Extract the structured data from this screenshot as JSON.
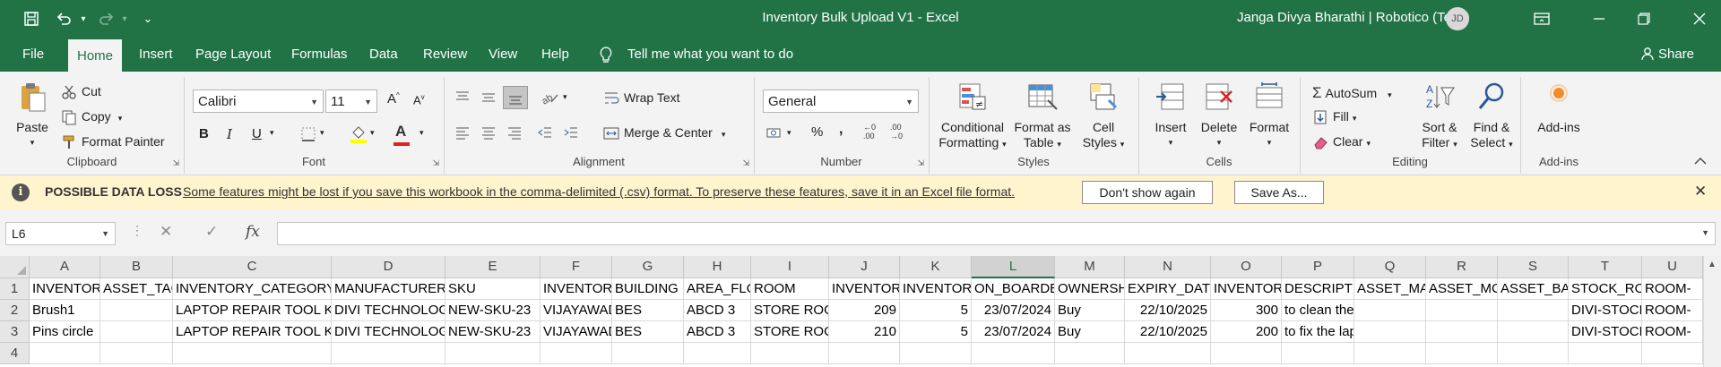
{
  "titlebar": {
    "title": "Inventory Bulk Upload V1  -  Excel",
    "user": "Janga Divya Bharathi | Robotico (Tech)",
    "initials": "JD",
    "qa_more": "⌄"
  },
  "tabs": [
    "File",
    "Home",
    "Insert",
    "Page Layout",
    "Formulas",
    "Data",
    "Review",
    "View",
    "Help"
  ],
  "tell_me": "Tell me what you want to do",
  "share": "Share",
  "ribbon": {
    "clipboard": {
      "paste": "Paste",
      "cut": "Cut",
      "copy": "Copy",
      "format_painter": "Format Painter",
      "label": "Clipboard"
    },
    "font": {
      "name": "Calibri",
      "size": "11",
      "label": "Font",
      "bold": "B",
      "italic": "I",
      "underline": "U"
    },
    "alignment": {
      "wrap": "Wrap Text",
      "merge": "Merge & Center",
      "label": "Alignment"
    },
    "number": {
      "format": "General",
      "percent": "%",
      "comma": ",",
      "label": "Number"
    },
    "styles": {
      "conditional": "Conditional",
      "conditional2": "Formatting",
      "format_table": "Format as",
      "format_table2": "Table",
      "cell_styles": "Cell",
      "cell_styles2": "Styles",
      "label": "Styles"
    },
    "cells": {
      "insert": "Insert",
      "delete": "Delete",
      "format": "Format",
      "label": "Cells"
    },
    "editing": {
      "autosum": "AutoSum",
      "fill": "Fill",
      "clear": "Clear",
      "sort": "Sort &",
      "sort2": "Filter",
      "find": "Find &",
      "find2": "Select",
      "label": "Editing"
    },
    "addins": {
      "addins": "Add-ins",
      "label": "Add-ins"
    }
  },
  "message": {
    "title": "POSSIBLE DATA LOSS",
    "text": "Some features might be lost if you save this workbook in the comma-delimited (.csv) format. To preserve these features, save it in an Excel file format.",
    "dont_show": "Don't show again",
    "save_as": "Save As..."
  },
  "formula_bar": {
    "name_box": "L6",
    "fx": "fx",
    "value": ""
  },
  "grid": {
    "columns": [
      "A",
      "B",
      "C",
      "D",
      "E",
      "F",
      "G",
      "H",
      "I",
      "J",
      "K",
      "L",
      "M",
      "N",
      "O",
      "P",
      "Q",
      "R",
      "S",
      "T",
      "U"
    ],
    "selected_column": "L",
    "rows": [
      "1",
      "2",
      "3",
      "4"
    ],
    "cells": [
      [
        "INVENTORY_NAME",
        "ASSET_TAG",
        "INVENTORY_CATEGORY",
        "MANUFACTURER",
        "SKU",
        "INVENTORY",
        "BUILDING",
        "AREA_FLOOR",
        "ROOM",
        "INVENTORY",
        "INVENTORY",
        "ON_BOARDED",
        "OWNERSHIP",
        "EXPIRY_DATE",
        "INVENTORY",
        "DESCRIPTION",
        "ASSET_MA",
        "ASSET_MC",
        "ASSET_BAI",
        "STOCK_ROOM",
        "ROOM-"
      ],
      [
        "Brush1",
        "",
        "LAPTOP REPAIR TOOL KIT",
        "DIVI TECHNOLOGIES",
        "NEW-SKU-23",
        "VIJAYAWADA",
        "BES",
        "ABCD 3",
        "STORE ROOM",
        "209",
        "5",
        "23/07/2024",
        "Buy",
        "22/10/2025",
        "300",
        "to clean the laptop",
        "",
        "",
        "",
        "DIVI-STOCK",
        "ROOM-"
      ],
      [
        "Pins circle",
        "",
        "LAPTOP REPAIR TOOL KIT",
        "DIVI TECHNOLOGIES",
        "NEW-SKU-23",
        "VIJAYAWADA",
        "BES",
        "ABCD 3",
        "STORE ROOM",
        "210",
        "5",
        "23/07/2024",
        "Buy",
        "22/10/2025",
        "200",
        "to fix the laptop",
        "",
        "",
        "",
        "DIVI-STOCK",
        "ROOM-"
      ],
      [
        "",
        "",
        "",
        "",
        "",
        "",
        "",
        "",
        "",
        "",
        "",
        "",
        "",
        "",
        "",
        "",
        "",
        "",
        "",
        "",
        ""
      ]
    ]
  }
}
